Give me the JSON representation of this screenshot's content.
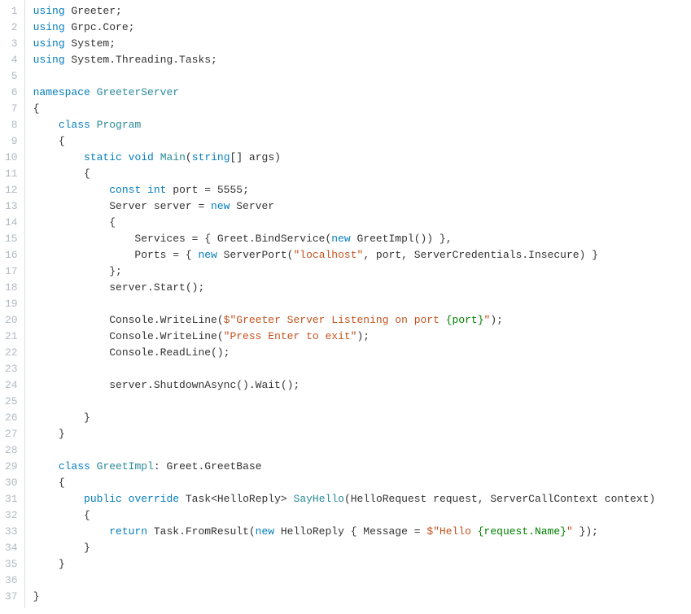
{
  "lineCount": 37,
  "tokens": {
    "kw": {
      "using": "using",
      "namespace": "namespace",
      "class": "class",
      "static": "static",
      "void": "void",
      "const": "const",
      "int": "int",
      "new": "new",
      "public": "public",
      "override": "override",
      "return": "return",
      "string": "string"
    },
    "type": {
      "GreeterServer": "GreeterServer",
      "Program": "Program",
      "Main": "Main",
      "GreetImpl": "GreetImpl",
      "SayHello": "SayHello"
    },
    "str": {
      "localhost": "\"localhost\"",
      "greeterListen1": "\"Greeter Server Listening on port ",
      "greeterListen2": "\"",
      "pressEnter": "\"Press Enter to exit\"",
      "hello1": "\"Hello ",
      "hello2": "\""
    },
    "interp": {
      "port": "{port}",
      "reqName": "{request.Name}"
    },
    "plain": {
      "l1": " Greeter;",
      "l2": " Grpc.Core;",
      "l3": " System;",
      "l4": " System.Threading.Tasks;",
      "l7": "{",
      "l9": "    {",
      "mainArgs": "[] args)",
      "l11": "        {",
      "portDecl": " port = 5555;",
      "serverDecl": "            Server server = ",
      "serverWord": " Server",
      "l14": "            {",
      "l15a": "                Services = { Greet.BindService(",
      "l15b": " GreetImpl()) },",
      "l16a": "                Ports = { ",
      "l16b": " ServerPort(",
      "l16c": ", port, ServerCredentials.Insecure) }",
      "l17": "            };",
      "l18": "            server.Start();",
      "l20a": "            Console.WriteLine(",
      "l20dollar": "$",
      "l20end": ");",
      "l21a": "            Console.WriteLine(",
      "l21end": ");",
      "l22": "            Console.ReadLine();",
      "l24": "            server.ShutdownAsync().Wait();",
      "l26": "        }",
      "l27": "    }",
      "l29rest": ": Greet.GreetBase",
      "l30": "    {",
      "l31a": " Task<HelloReply> ",
      "l31b": "(HelloRequest request, ServerCallContext context)",
      "l32": "        {",
      "l33a": " Task.FromResult(",
      "l33b": " HelloReply { Message = ",
      "l33dollar": "$",
      "l33end": " });",
      "l34": "        }",
      "l35": "    }",
      "l37": "}"
    }
  }
}
